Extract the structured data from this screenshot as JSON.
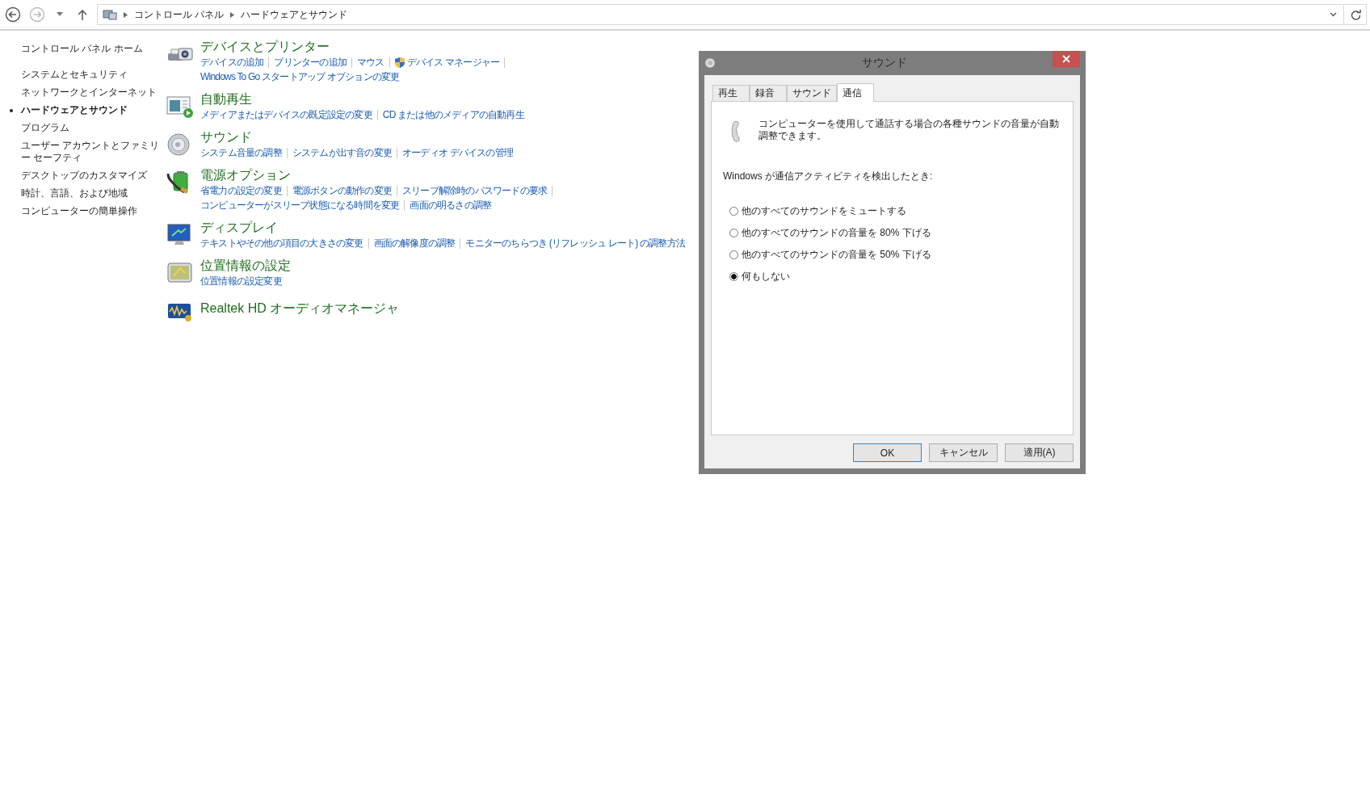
{
  "address_bar": {
    "breadcrumbs": [
      "コントロール パネル",
      "ハードウェアとサウンド"
    ]
  },
  "sidebar": {
    "home": "コントロール パネル ホーム",
    "items": [
      {
        "label": "システムとセキュリティ",
        "selected": false
      },
      {
        "label": "ネットワークとインターネット",
        "selected": false
      },
      {
        "label": "ハードウェアとサウンド",
        "selected": true
      },
      {
        "label": "プログラム",
        "selected": false
      },
      {
        "label": "ユーザー アカウントとファミリー セーフティ",
        "selected": false
      },
      {
        "label": "デスクトップのカスタマイズ",
        "selected": false
      },
      {
        "label": "時計、言語、および地域",
        "selected": false
      },
      {
        "label": "コンピューターの簡単操作",
        "selected": false
      }
    ]
  },
  "categories": [
    {
      "kind": "devices",
      "title": "デバイスとプリンター",
      "lines": [
        {
          "trailing_separator": true,
          "links": [
            {
              "text": "デバイスの追加",
              "shield": false
            },
            {
              "text": "プリンターの追加",
              "shield": false
            },
            {
              "text": "マウス",
              "shield": false
            },
            {
              "text": "デバイス マネージャー",
              "shield": true
            }
          ]
        },
        {
          "trailing_separator": false,
          "links": [
            {
              "text": "Windows To Go スタートアップ オプションの変更",
              "shield": false
            }
          ]
        }
      ]
    },
    {
      "kind": "autoplay",
      "title": "自動再生",
      "lines": [
        {
          "trailing_separator": false,
          "links": [
            {
              "text": "メディアまたはデバイスの既定設定の変更",
              "shield": false
            },
            {
              "text": "CD または他のメディアの自動再生",
              "shield": false
            }
          ]
        }
      ]
    },
    {
      "kind": "sound",
      "title": "サウンド",
      "lines": [
        {
          "trailing_separator": false,
          "links": [
            {
              "text": "システム音量の調整",
              "shield": false
            },
            {
              "text": "システムが出す音の変更",
              "shield": false
            },
            {
              "text": "オーディオ デバイスの管理",
              "shield": false
            }
          ]
        }
      ]
    },
    {
      "kind": "power",
      "title": "電源オプション",
      "lines": [
        {
          "trailing_separator": true,
          "links": [
            {
              "text": "省電力の設定の変更",
              "shield": false
            },
            {
              "text": "電源ボタンの動作の変更",
              "shield": false
            },
            {
              "text": "スリープ解除時のパスワードの要求",
              "shield": false
            }
          ]
        },
        {
          "trailing_separator": false,
          "links": [
            {
              "text": "コンピューターがスリープ状態になる時間を変更",
              "shield": false
            },
            {
              "text": "画面の明るさの調整",
              "shield": false
            }
          ]
        }
      ]
    },
    {
      "kind": "display",
      "title": "ディスプレイ",
      "lines": [
        {
          "trailing_separator": false,
          "links": [
            {
              "text": "テキストやその他の項目の大きさの変更",
              "shield": false
            },
            {
              "text": "画面の解像度の調整",
              "shield": false
            },
            {
              "text": "モニターのちらつき (リフレッシュ レート) の調整方法",
              "shield": false
            }
          ]
        }
      ]
    },
    {
      "kind": "location",
      "title": "位置情報の設定",
      "lines": [
        {
          "trailing_separator": false,
          "links": [
            {
              "text": "位置情報の設定変更",
              "shield": false
            }
          ]
        }
      ]
    },
    {
      "kind": "realtek",
      "title": "Realtek HD オーディオマネージャ"
    }
  ],
  "dialog": {
    "title": "サウンド",
    "tabs": [
      {
        "label": "再生",
        "selected": false
      },
      {
        "label": "録音",
        "selected": false
      },
      {
        "label": "サウンド",
        "selected": false
      },
      {
        "label": "通信",
        "selected": true
      }
    ],
    "description": "コンピューターを使用して通話する場合の各種サウンドの音量が自動調整できます。",
    "prompt": "Windows が通信アクティビティを検出したとき:",
    "options": [
      {
        "label": "他のすべてのサウンドをミュートする",
        "selected": false
      },
      {
        "label": "他のすべてのサウンドの音量を 80% 下げる",
        "selected": false
      },
      {
        "label": "他のすべてのサウンドの音量を 50% 下げる",
        "selected": false
      },
      {
        "label": "何もしない",
        "selected": true
      }
    ],
    "buttons": [
      {
        "label": "OK",
        "default": true
      },
      {
        "label": "キャンセル",
        "default": false
      },
      {
        "label": "適用(A)",
        "default": false
      }
    ]
  }
}
